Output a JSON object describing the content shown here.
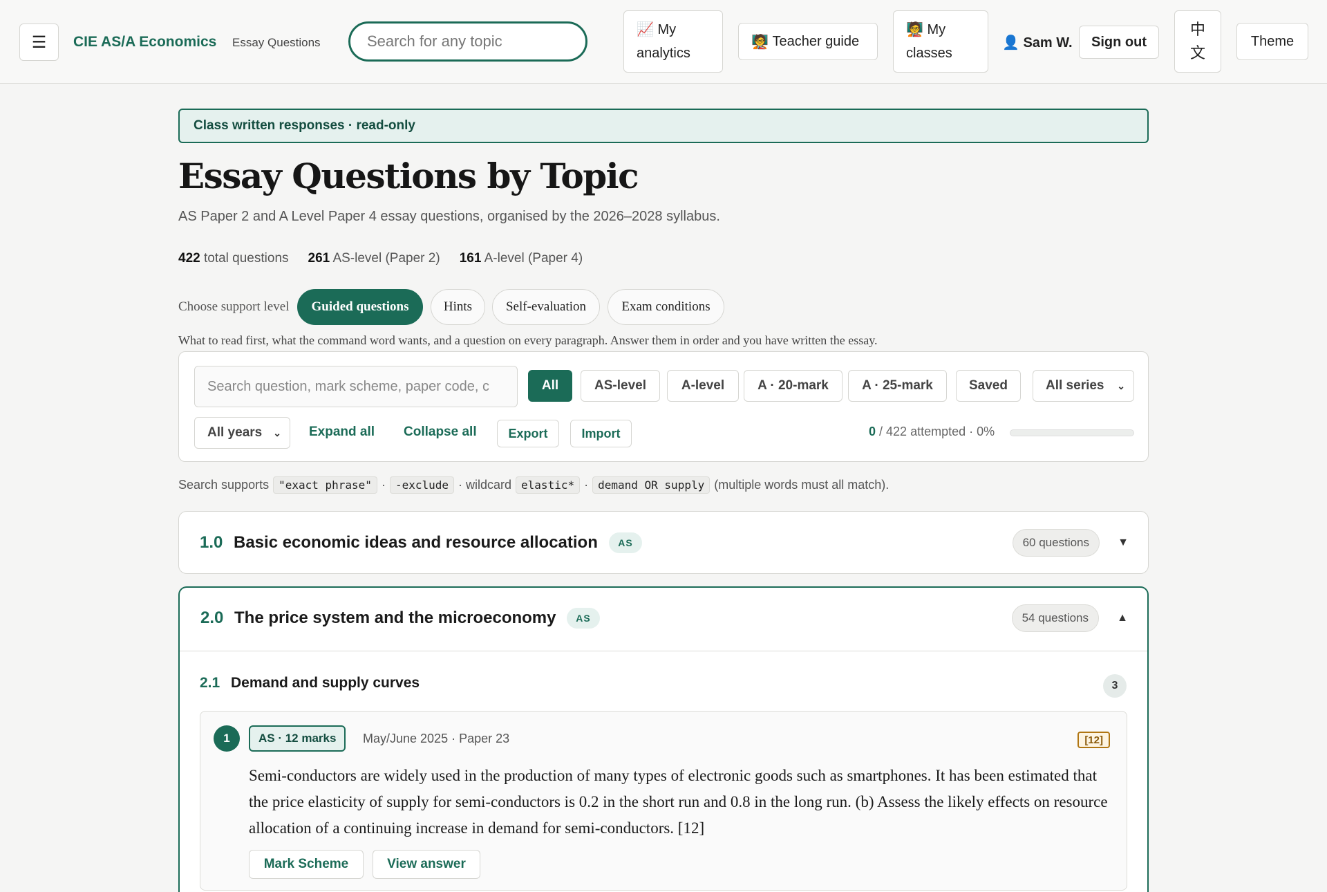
{
  "topbar": {
    "menu_icon": "hamburger-icon",
    "brand": "CIE AS/A Economics",
    "brand_sub": "Essay Questions",
    "search_placeholder": "Search for any topic",
    "analytics_emoji": "📈",
    "analytics_label_1": "My",
    "analytics_label_2": "analytics",
    "teacher_emoji": "🧑‍🏫",
    "teacher_label": "Teacher guide",
    "classes_emoji": "🧑‍🏫",
    "classes_label_1": "My",
    "classes_label_2": "classes",
    "user_emoji": "👤",
    "user_name": "Sam W.",
    "signout": "Sign out",
    "lang_1": "中",
    "lang_2": "文",
    "theme": "Theme"
  },
  "banner": "Class written responses · read-only",
  "title": "Essay Questions by Topic",
  "subtitle": "AS Paper 2 and A Level Paper 4 essay questions, organised by the 2026–2028 syllabus.",
  "stats": {
    "total_num": "422",
    "total_label": "total questions",
    "as_num": "261",
    "as_label": "AS-level (Paper 2)",
    "a_num": "161",
    "a_label": "A-level (Paper 4)"
  },
  "support": {
    "label": "Choose support level",
    "options": [
      "Guided questions",
      "Hints",
      "Self-evaluation",
      "Exam conditions"
    ],
    "active_index": 0,
    "description": "What to read first, what the command word wants, and a question on every paragraph. Answer them in order and you have written the essay."
  },
  "filters": {
    "search_placeholder": "Search question, mark scheme, paper code, c",
    "chips": [
      "All",
      "AS-level",
      "A-level",
      "A · 20-mark",
      "A · 25-mark",
      "Saved"
    ],
    "active_chip": 0,
    "series_select": "All series",
    "years_select": "All years",
    "expand_all": "Expand all",
    "collapse_all": "Collapse all",
    "export": "Export",
    "import": "Import",
    "attempted_num": "0",
    "attempted_rest": "/ 422 attempted · 0%",
    "progress_fraction": 0
  },
  "search_help": {
    "prefix": "Search supports",
    "exact": "\"exact phrase\"",
    "sep1": "·",
    "exclude": "-exclude",
    "wildcard_label": "· wildcard",
    "wildcard": "elastic*",
    "sep2": "·",
    "or": "demand OR supply",
    "suffix": "(multiple words must all match)."
  },
  "topics": [
    {
      "number": "1.0",
      "name": "Basic economic ideas and resource allocation",
      "level": "AS",
      "count": "60 questions",
      "caret": "▼"
    },
    {
      "number": "2.0",
      "name": "The price system and the microeconomy",
      "level": "AS",
      "count": "54 questions",
      "caret": "▲"
    }
  ],
  "subtopic": {
    "number": "2.1",
    "name": "Demand and supply curves",
    "count": "3"
  },
  "question": {
    "index": "1",
    "badge": "AS · 12 marks",
    "meta": "May/June 2025 · Paper 23",
    "marks": "[12]",
    "text": "Semi-conductors are widely used in the production of many types of electronic goods such as smartphones. It has been estimated that the price elasticity of supply for semi-conductors is 0.2 in the short run and 0.8 in the long run. (b) Assess the likely effects on resource allocation of a continuing increase in demand for semi-conductors. [12]",
    "mark_scheme": "Mark Scheme",
    "view_answer": "View answer"
  }
}
